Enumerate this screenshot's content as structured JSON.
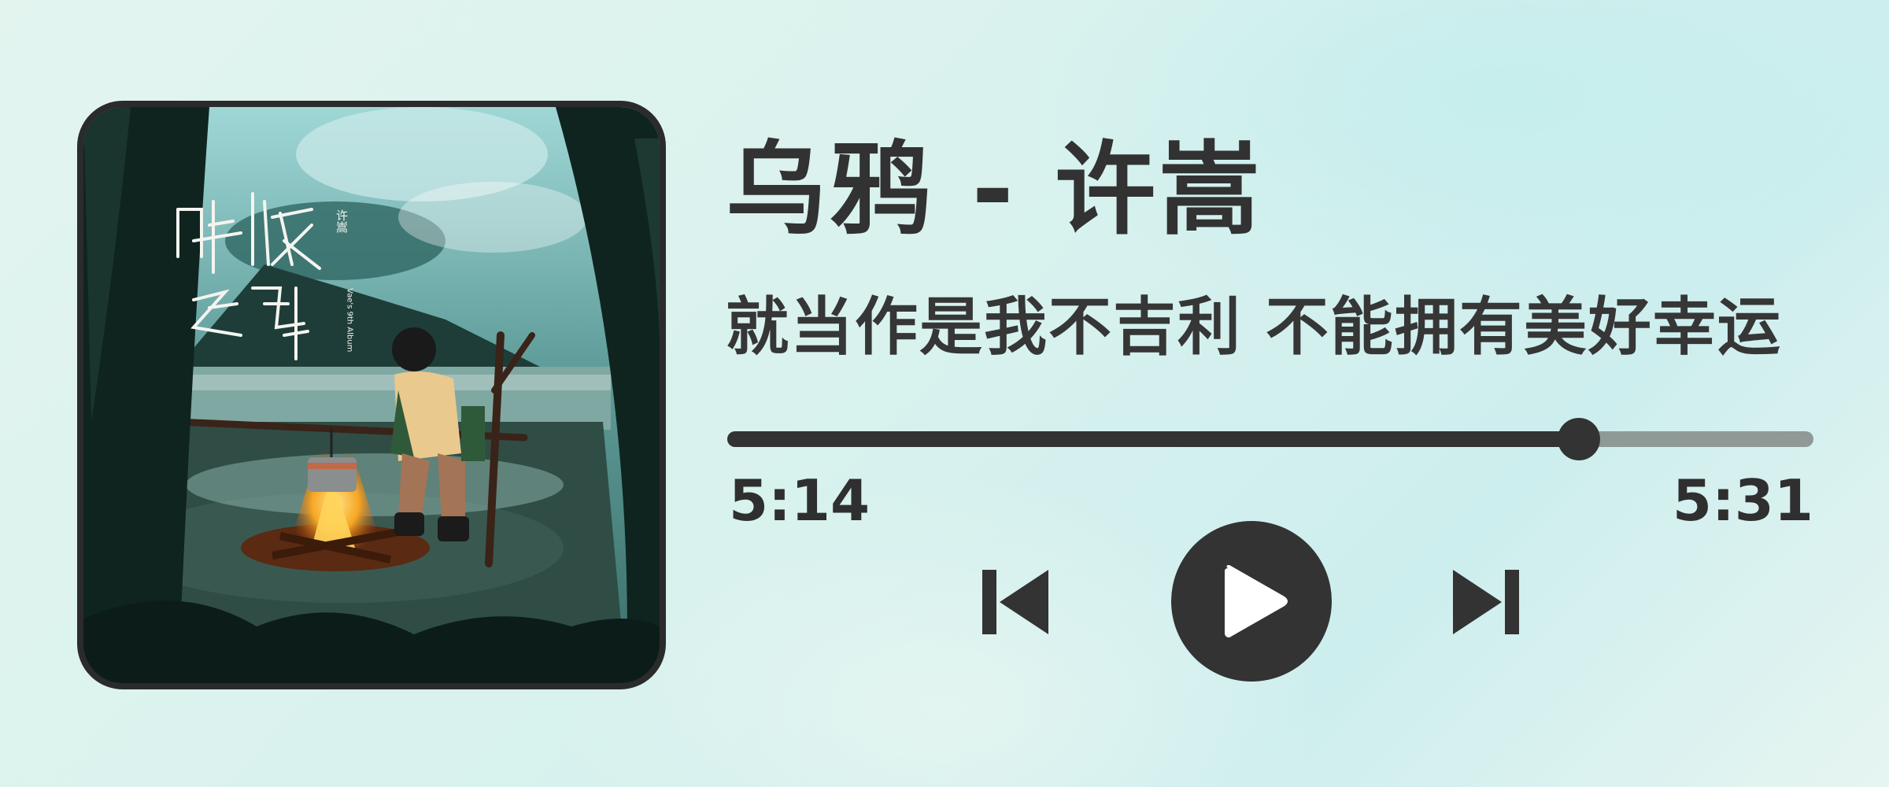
{
  "player": {
    "title": "乌鸦 - 许嵩",
    "lyric": "就当作是我不吉利 不能拥有美好幸运",
    "current_time": "5:14",
    "total_time": "5:31",
    "progress_fraction": 0.784
  },
  "album_art": {
    "title_text": "呼吸之野",
    "artist_text": "许嵩",
    "edition_text": "Vae's 9th Album"
  },
  "controls": {
    "previous_icon": "skip-previous-icon",
    "play_icon": "play-icon",
    "next_icon": "skip-next-icon"
  },
  "colors": {
    "background": "#d9f2ee",
    "text": "#333333",
    "progress_remaining": "#8f9a96"
  }
}
